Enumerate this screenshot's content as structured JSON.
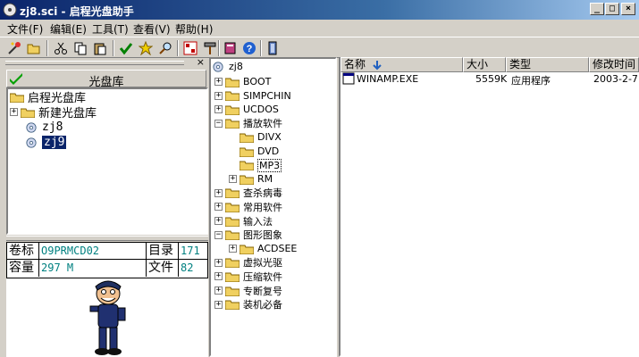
{
  "window": {
    "title": "zj8.sci - 启程光盘助手"
  },
  "menu": [
    "文件(F)",
    "编辑(E)",
    "工具(T)",
    "查看(V)",
    "帮助(H)"
  ],
  "left_panel": {
    "library_title": "光盘库",
    "tree": [
      {
        "label": "启程光盘库"
      },
      {
        "label": "新建光盘库"
      },
      {
        "label": "zj8"
      },
      {
        "label": "zj9"
      }
    ],
    "info": {
      "volume_label": "卷标",
      "volume_value": "O9PRMCD02",
      "dir_label": "目录",
      "dir_value": "171",
      "capacity_label": "容量",
      "capacity_value": "297 M",
      "file_label": "文件",
      "file_value": "82"
    }
  },
  "folder_tree": {
    "root": "zj8",
    "items": [
      {
        "label": "BOOT"
      },
      {
        "label": "SIMPCHIN"
      },
      {
        "label": "UCDOS"
      },
      {
        "label": "播放软件"
      },
      {
        "label": "DIVX"
      },
      {
        "label": "DVD"
      },
      {
        "label": "MP3"
      },
      {
        "label": "RM"
      },
      {
        "label": "查杀病毒"
      },
      {
        "label": "常用软件"
      },
      {
        "label": "输入法"
      },
      {
        "label": "图形图象"
      },
      {
        "label": "ACDSEE"
      },
      {
        "label": "虚拟光驱"
      },
      {
        "label": "压缩软件"
      },
      {
        "label": "专断复号"
      },
      {
        "label": "装机必备"
      }
    ]
  },
  "file_list": {
    "columns": [
      "名称",
      "大小",
      "类型",
      "修改时间"
    ],
    "rows": [
      {
        "name": "WINAMP.EXE",
        "size": "5559K",
        "type": "应用程序",
        "modified": "2003-2-7"
      }
    ]
  }
}
